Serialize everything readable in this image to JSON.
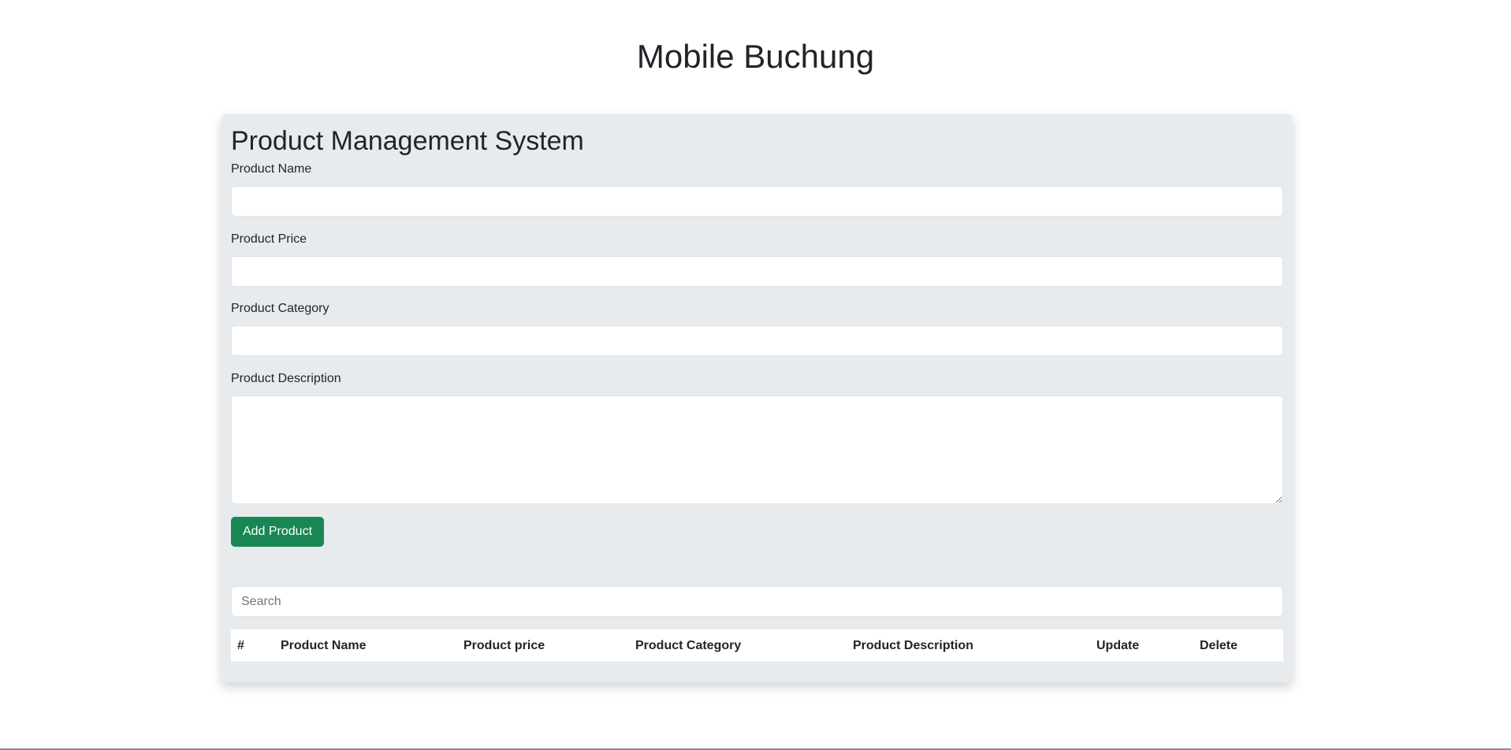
{
  "header": {
    "title": "Mobile Buchung"
  },
  "form": {
    "title": "Product Management System",
    "fields": {
      "name": {
        "label": "Product Name",
        "value": ""
      },
      "price": {
        "label": "Product Price",
        "value": ""
      },
      "category": {
        "label": "Product Category",
        "value": ""
      },
      "description": {
        "label": "Product Description",
        "value": ""
      }
    },
    "add_button_label": "Add Product"
  },
  "search": {
    "placeholder": "Search",
    "value": ""
  },
  "table": {
    "columns": [
      "#",
      "Product Name",
      "Product price",
      "Product Category",
      "Product Description",
      "Update",
      "Delete"
    ],
    "rows": []
  },
  "colors": {
    "card_background": "#e8ebee",
    "button_primary": "#198754",
    "text": "#212529"
  }
}
